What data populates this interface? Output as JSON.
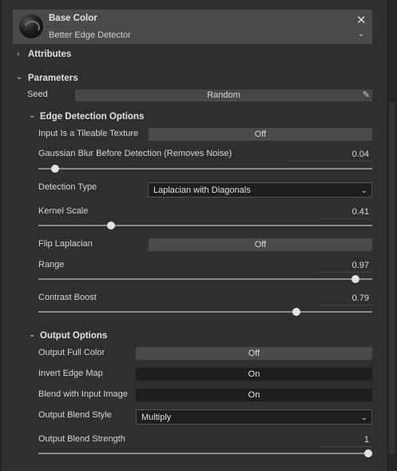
{
  "header": {
    "title": "Base Color",
    "subtitle": "Better Edge Detector",
    "close_glyph": "✕",
    "chevron_glyph": "⌄"
  },
  "sections": {
    "attributes": "Attributes",
    "parameters": "Parameters",
    "edge_detection": "Edge Detection Options",
    "output": "Output Options"
  },
  "seed": {
    "label": "Seed",
    "button": "Random"
  },
  "edge": {
    "tileable": {
      "label": "Input Is a Tileable Texture",
      "value": "Off"
    },
    "blur": {
      "label": "Gaussian Blur Before Detection (Removes Noise)",
      "value": "0.04",
      "fraction": 0.04
    },
    "detection_type": {
      "label": "Detection Type",
      "value": "Laplacian with Diagonals"
    },
    "kernel_scale": {
      "label": "Kernel Scale",
      "value": "0.41",
      "fraction": 0.21
    },
    "flip": {
      "label": "Flip Laplacian",
      "value": "Off"
    },
    "range": {
      "label": "Range",
      "value": "0.97",
      "fraction": 0.96
    },
    "contrast": {
      "label": "Contrast Boost",
      "value": "0.79",
      "fraction": 0.78
    }
  },
  "output": {
    "full_color": {
      "label": "Output Full Color",
      "value": "Off"
    },
    "invert": {
      "label": "Invert Edge Map",
      "value": "On"
    },
    "blend_input": {
      "label": "Blend with Input Image",
      "value": "On"
    },
    "blend_style": {
      "label": "Output Blend Style",
      "value": "Multiply"
    },
    "blend_strength": {
      "label": "Output Blend Strength",
      "value": "1",
      "fraction": 1.0
    }
  },
  "icons": {
    "collapsed_arrow": "›",
    "expanded_arrow": "⌄",
    "pencil": "✎"
  },
  "colors": {
    "panel": "#2f2f2f",
    "header": "#4a4a4a",
    "on_button": "#1e1e1e",
    "off_button": "#4a4a4a"
  }
}
